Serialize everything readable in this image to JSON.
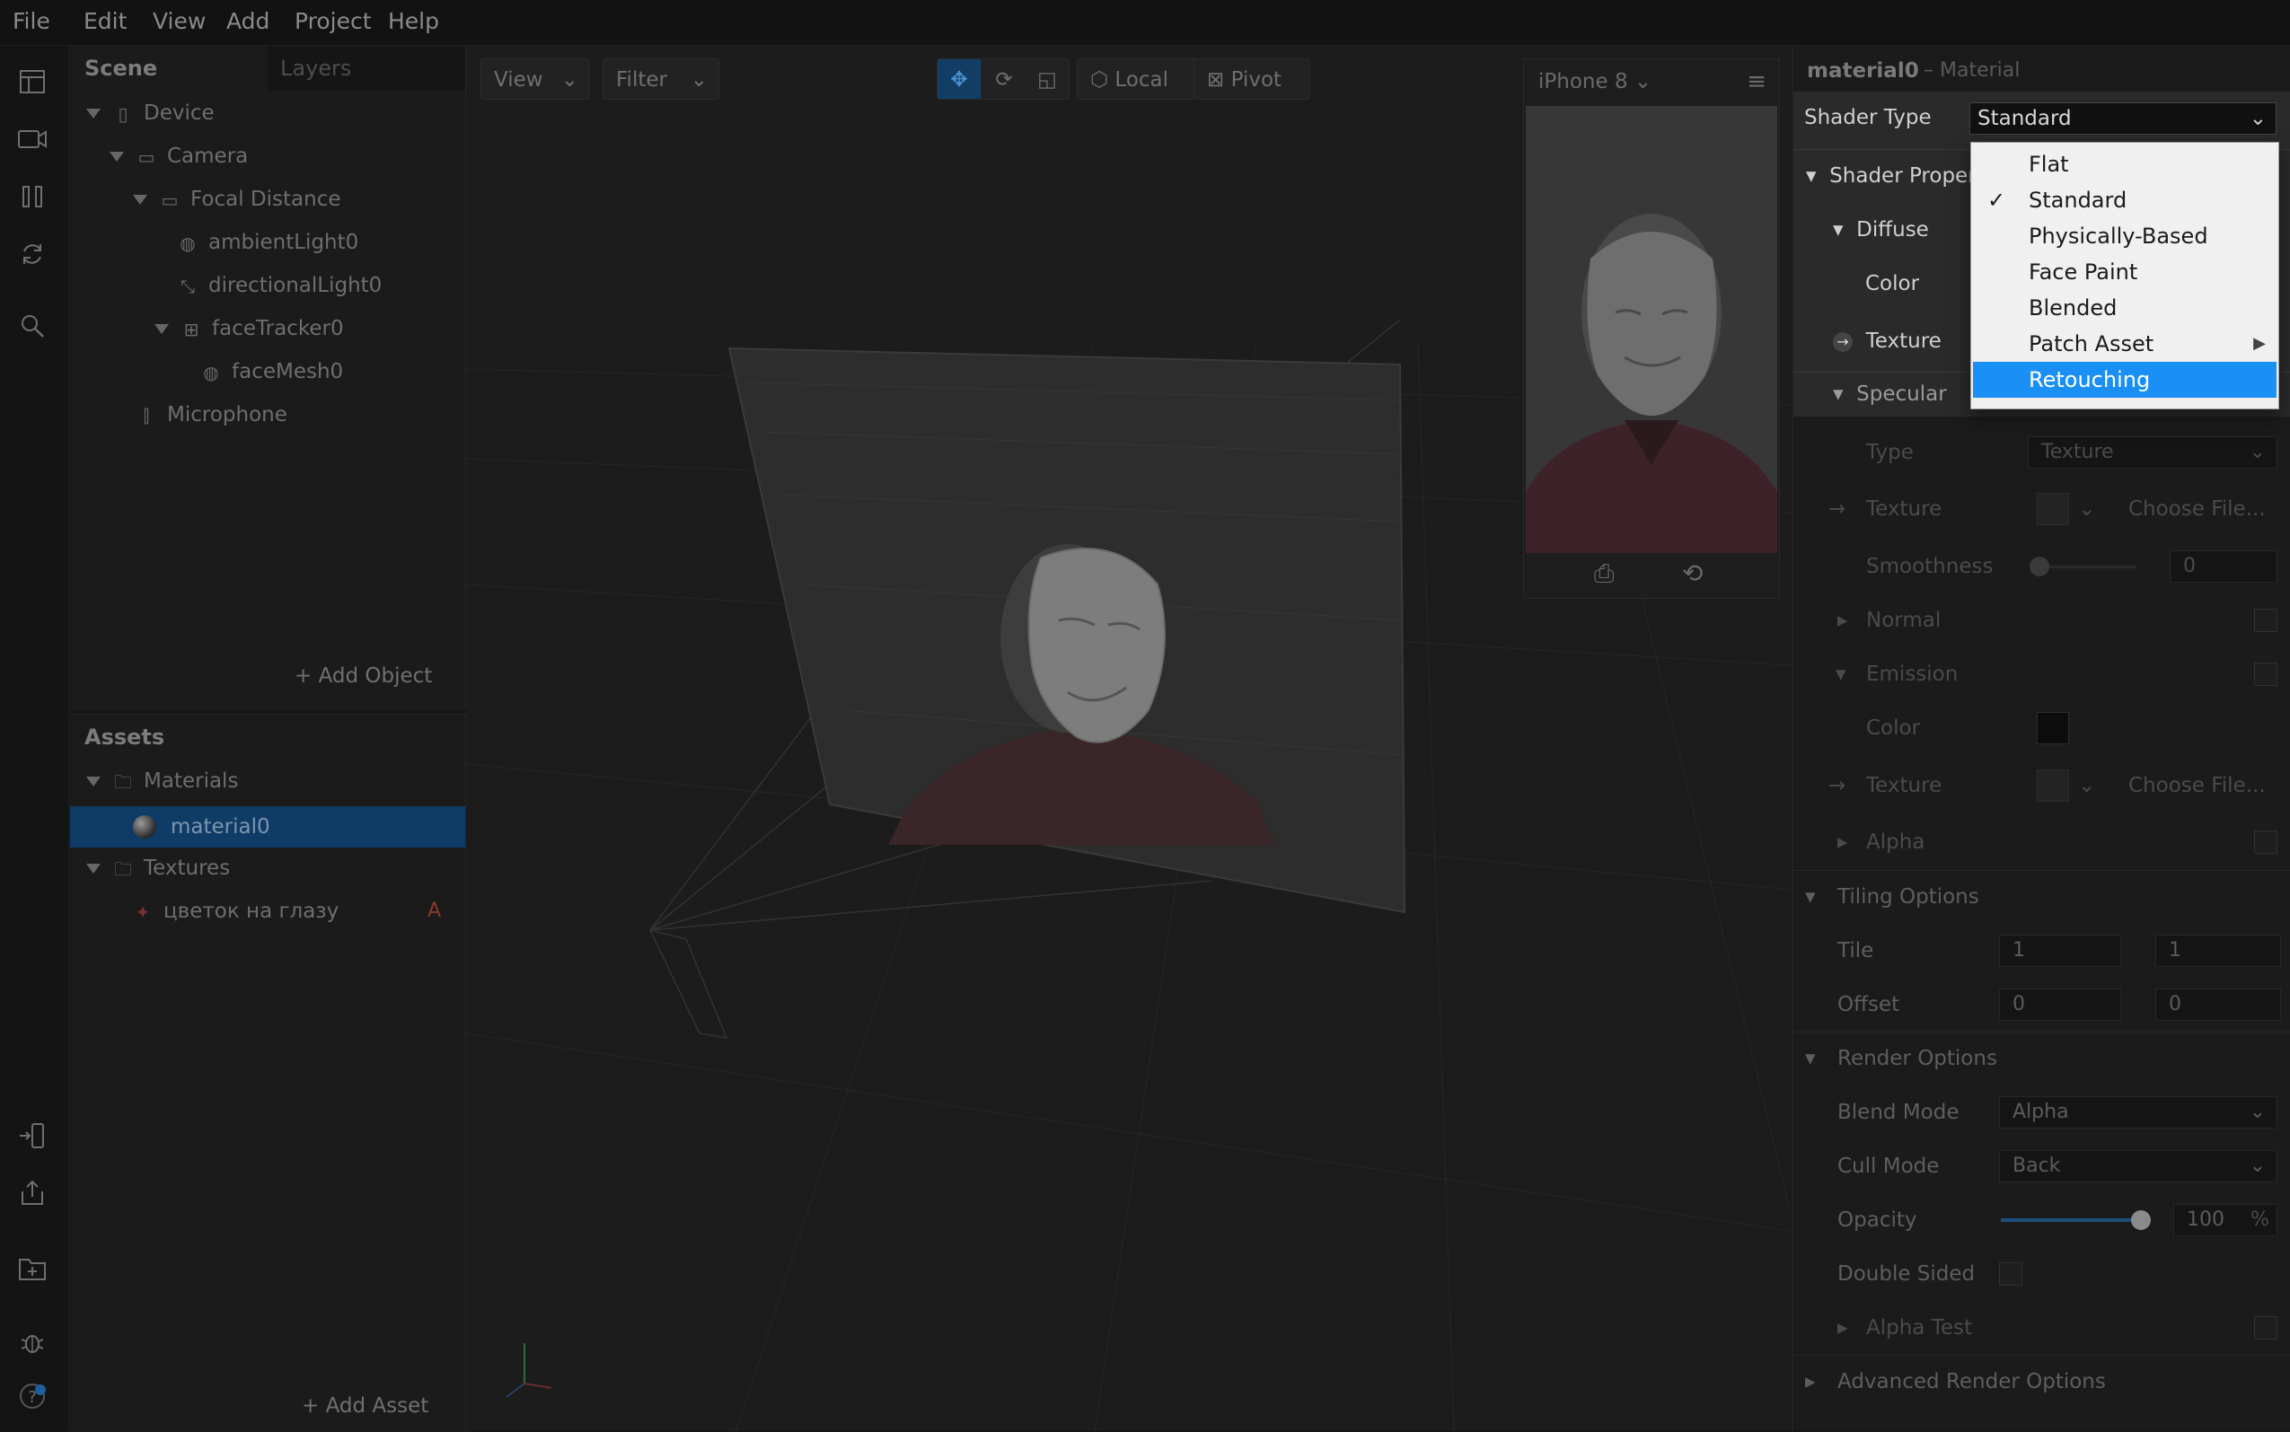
{
  "menu": [
    "File",
    "Edit",
    "View",
    "Add",
    "Project",
    "Help"
  ],
  "scene": {
    "tabs": [
      "Scene",
      "Layers"
    ],
    "items": [
      {
        "label": "Device",
        "icon": "device-icon"
      },
      {
        "label": "Camera",
        "icon": "camera-icon"
      },
      {
        "label": "Focal Distance",
        "icon": "ruler-icon"
      },
      {
        "label": "ambientLight0",
        "icon": "globe-icon"
      },
      {
        "label": "directionalLight0",
        "icon": "light-icon"
      },
      {
        "label": "faceTracker0",
        "icon": "face-tracker-icon"
      },
      {
        "label": "faceMesh0",
        "icon": "mesh-icon"
      },
      {
        "label": "Microphone",
        "icon": "microphone-icon"
      }
    ],
    "add_object": "+ Add Object"
  },
  "assets": {
    "title": "Assets",
    "items": [
      {
        "label": "Materials"
      },
      {
        "label": "material0"
      },
      {
        "label": "Textures"
      },
      {
        "label": "цветок на глазу",
        "badge": "A"
      }
    ],
    "add_asset": "+ Add Asset"
  },
  "viewport": {
    "view": "View",
    "filter": "Filter",
    "local": "Local",
    "pivot": "Pivot",
    "device": "iPhone 8"
  },
  "inspector": {
    "title": "material0",
    "subtitle": "– Material",
    "shader_type_label": "Shader Type",
    "shader_type_value": "Standard",
    "shader_properties": "Shader Proper",
    "diffuse": "Diffuse",
    "color": "Color",
    "texture": "Texture",
    "specular": "Specular",
    "type": "Type",
    "type_value": "Texture",
    "texture2": "Texture",
    "choose_file": "Choose File...",
    "smoothness": "Smoothness",
    "smoothness_value": "0",
    "normal": "Normal",
    "emission": "Emission",
    "color2": "Color",
    "texture3": "Texture",
    "choose_file2": "Choose File...",
    "alpha": "Alpha",
    "tiling_options": "Tiling Options",
    "tile": "Tile",
    "tile_x": "1",
    "tile_y": "1",
    "offset": "Offset",
    "offset_x": "0",
    "offset_y": "0",
    "render_options": "Render Options",
    "blend_mode": "Blend Mode",
    "blend_mode_value": "Alpha",
    "cull_mode": "Cull Mode",
    "cull_mode_value": "Back",
    "opacity": "Opacity",
    "opacity_value": "100",
    "opacity_unit": "%",
    "opacity_level": 1.0,
    "double_sided": "Double Sided",
    "alpha_test": "Alpha Test",
    "advanced_render_options": "Advanced Render Options"
  },
  "dropdown": {
    "options": [
      "Flat",
      "Standard",
      "Physically-Based",
      "Face Paint",
      "Blended",
      "Patch Asset",
      "Retouching"
    ],
    "checked": "Standard",
    "highlighted": "Retouching"
  }
}
